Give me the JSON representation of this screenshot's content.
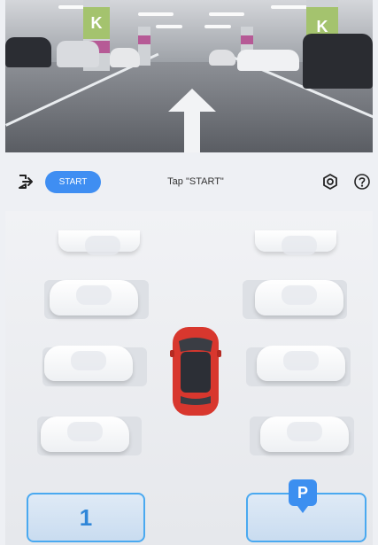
{
  "toolbar": {
    "start_label": "START",
    "hint_text": "Tap \"START\""
  },
  "camera": {
    "pillar_letter": "K"
  },
  "parking_bay": {
    "number": "1",
    "target_marker": "P"
  },
  "icons": {
    "exit": "exit-icon",
    "settings": "settings-icon",
    "help": "help-icon",
    "forward": "forward-arrow-icon",
    "parking_marker": "parking-pin-icon"
  },
  "colors": {
    "accent": "#3f8ef2",
    "bay_outline": "#4aa9f0",
    "ego_car": "#d8372e",
    "pillar_tag": "#a4c36e",
    "pillar_band": "#b65a96"
  }
}
